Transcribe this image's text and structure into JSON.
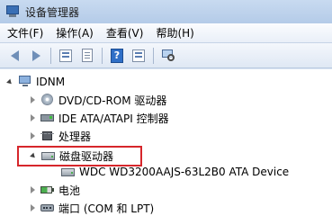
{
  "window": {
    "title": "设备管理器"
  },
  "menu": [
    "文件(F)",
    "操作(A)",
    "查看(V)",
    "帮助(H)"
  ],
  "toolbar": {
    "buttons": [
      "back-icon",
      "forward-icon",
      "properties-icon",
      "window-icon",
      "help-icon",
      "refresh-icon",
      "scan-hardware-icon"
    ]
  },
  "tree": {
    "root": "IDNM",
    "items": [
      {
        "label": "DVD/CD-ROM 驱动器",
        "icon": "disc-drive-icon",
        "expanded": false
      },
      {
        "label": "IDE ATA/ATAPI 控制器",
        "icon": "ide-controller-icon",
        "expanded": false
      },
      {
        "label": "处理器",
        "icon": "processor-icon",
        "expanded": false
      },
      {
        "label": "磁盘驱动器",
        "icon": "disk-drive-icon",
        "expanded": true,
        "highlighted": true,
        "children": [
          {
            "label": "WDC WD3200AAJS-63L2B0 ATA Device",
            "icon": "hard-disk-icon"
          }
        ]
      },
      {
        "label": "电池",
        "icon": "battery-icon",
        "expanded": false
      },
      {
        "label": "端口 (COM 和 LPT)",
        "icon": "port-icon",
        "expanded": false
      }
    ]
  },
  "colors": {
    "highlight": "#d6262b",
    "chrome": "#dbe6f4"
  }
}
